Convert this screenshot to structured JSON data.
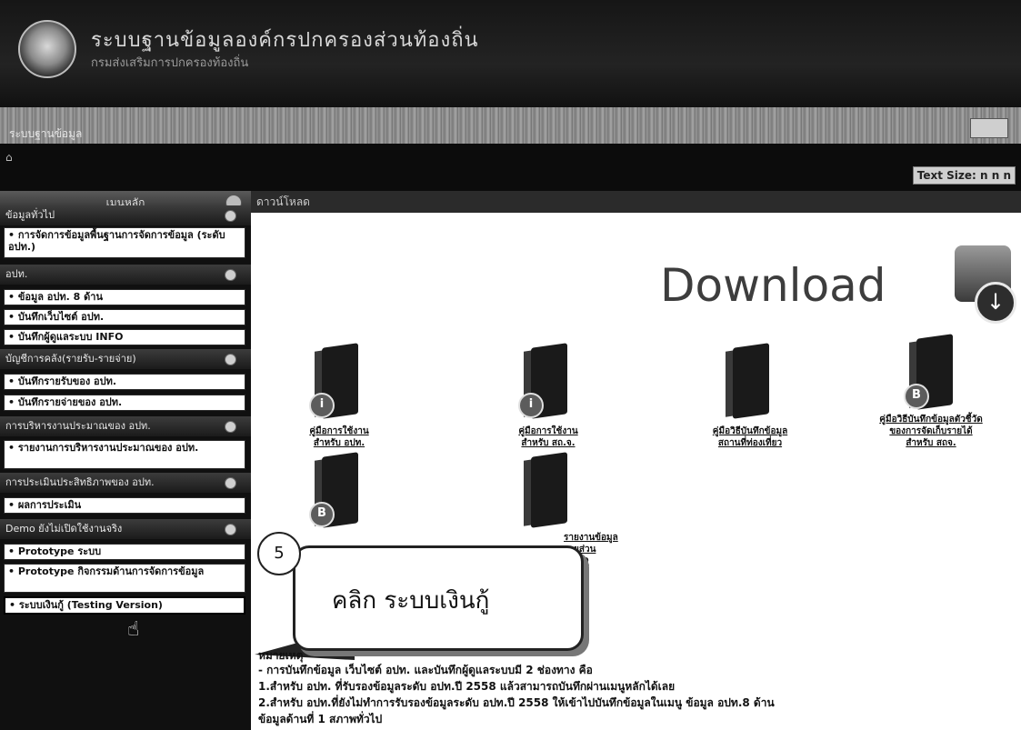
{
  "header": {
    "title": "ระบบฐานข้อมูลองค์กรปกครองส่วนท้องถิ่น",
    "subtitle": "กรมส่งเสริมการปกครองท้องถิ่น"
  },
  "nav": {
    "current": "ระบบฐานข้อมูล",
    "text_size_label": "Text Size: n n n"
  },
  "sidebar": {
    "header": "เมนูหลัก",
    "sections": [
      {
        "title": "ข้อมูลทั่วไป",
        "items": [
          "• การจัดการข้อมูลพื้นฐานการจัดการข้อมูล (ระดับ อปท.)"
        ]
      },
      {
        "title": "อปท.",
        "items": [
          "• ข้อมูล อปท. 8 ด้าน",
          "• บันทึกเว็บไซต์ อปท.",
          "• บันทึกผู้ดูแลระบบ INFO"
        ]
      },
      {
        "title": "บัญชีการคลัง(รายรับ-รายจ่าย)",
        "items": [
          "• บันทึกรายรับของ อปท.",
          "• บันทึกรายจ่ายของ อปท."
        ]
      },
      {
        "title": "การบริหารงานประมาณของ อปท.",
        "items": [
          "• รายงานการบริหารงานประมาณของ อปท."
        ]
      },
      {
        "title": "การประเมินประสิทธิภาพของ อปท.",
        "items": [
          "• ผลการประเมิน"
        ]
      },
      {
        "title": "Demo ยังไม่เปิดใช้งานจริง",
        "items": [
          "• Prototype ระบบ",
          "• Prototype กิจกรรมด้านการจัดการข้อมูล",
          "• ระบบเงินกู้ (Testing Version)"
        ]
      }
    ]
  },
  "main": {
    "header": "ดาวน์โหลด",
    "download_word": "Download",
    "downloads": [
      {
        "label": "คู่มือการใช้งาน\nสำหรับ อปท.",
        "badge": "i"
      },
      {
        "label": "คู่มือการใช้งาน\nสำหรับ สถ.จ.",
        "badge": "i"
      },
      {
        "label": "คู่มือวิธีบันทึกข้อมูล\nสถานที่ท่องเที่ยว",
        "badge": ""
      },
      {
        "label": "คู่มือวิธีบันทึกข้อมูลตัวชี้วัด\nของการจัดเก็บรายได้\nสำหรับ สถจ.",
        "badge": "B"
      },
      {
        "label": "",
        "badge": "B"
      },
      {
        "label": "รายงานข้อมูล\nรายส่วน\n2559",
        "badge": ""
      }
    ],
    "callout": {
      "step": "5",
      "text": "คลิก ระบบเงินกู้"
    },
    "body_lines": [
      "หมายเหตุ",
      "- การบันทึกข้อมูล เว็บไซต์ อปท. และบันทึกผู้ดูแลระบบมี 2 ช่องทาง คือ",
      "1.สำหรับ อปท. ที่รับรองข้อมูลระดับ อปท.ปี 2558 แล้วสามารถบันทึกผ่านเมนูหลักได้เลย",
      "2.สำหรับ อปท.ที่ยังไม่ทำการรับรองข้อมูลระดับ อปท.ปี 2558 ให้เข้าไปบันทึกข้อมูลในเมนู ข้อมูล อปท.8 ด้าน",
      "ข้อมูลด้านที่ 1 สภาพทั่วไป"
    ]
  }
}
